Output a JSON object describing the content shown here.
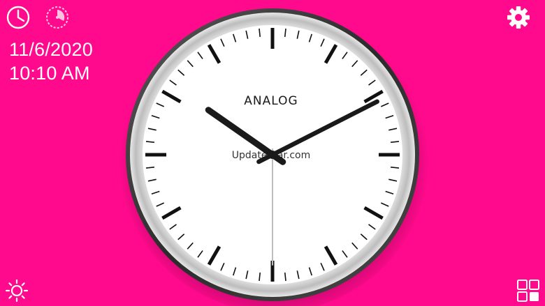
{
  "date": "11/6/2020",
  "time": "10:10 AM",
  "clock": {
    "label": "ANALOG",
    "watermark": "UpdateStar.com",
    "hour": 10,
    "minute": 10,
    "second": 30
  },
  "icons": {
    "clock_mode": "clock-icon",
    "timer_mode": "timer-icon",
    "settings": "gear-icon",
    "brightness": "brightness-icon",
    "layouts": "grid-icon"
  },
  "colors": {
    "background": "#ff0a8c",
    "face": "#ffffff",
    "rim": "#3a3a3a",
    "hands": "#1a1a1a"
  }
}
